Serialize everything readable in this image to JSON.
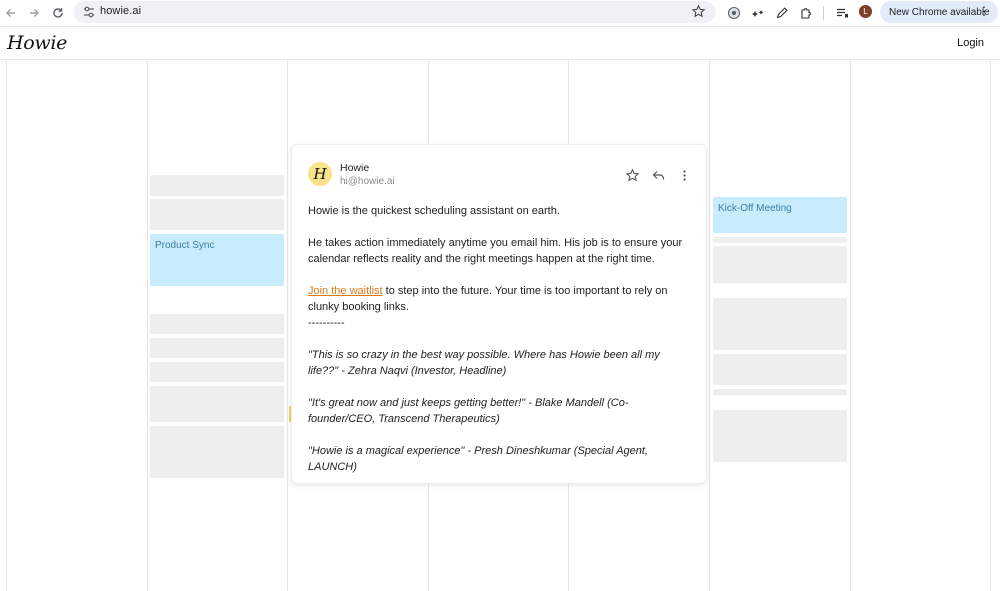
{
  "browser": {
    "url": "howie.ai",
    "update_button": "New Chrome available",
    "profile_initial": "L"
  },
  "header": {
    "logo": "Howie",
    "login_label": "Login"
  },
  "calendar": {
    "events": [
      {
        "label": "Product Sync"
      },
      {
        "label": "Kick-Off Meeting"
      }
    ]
  },
  "email": {
    "sender_initial": "H",
    "sender_name": "Howie",
    "sender_email": "hi@howie.ai",
    "intro": "Howie is the quickest scheduling assistant on earth.",
    "paragraph2": "He takes action immediately anytime you email him. His job is to ensure your calendar reflects reality and the right meetings happen at the right time.",
    "waitlist_link": "Join the waitlist",
    "paragraph3_rest": " to step into the future. Your time is too important to rely on clunky booking links.",
    "divider": "----------",
    "quote1": "\"This is so crazy in the best way possible. Where has Howie been all my life??\" - Zehra Naqvi (Investor, Headline)",
    "quote2": "\"It's great now and just keeps getting better!\" - Blake Mandell (Co-founder/CEO, Transcend Therapeutics)",
    "quote3": "\"Howie is a magical experience\" - Presh Dineshkumar (Special Agent, LAUNCH)"
  }
}
